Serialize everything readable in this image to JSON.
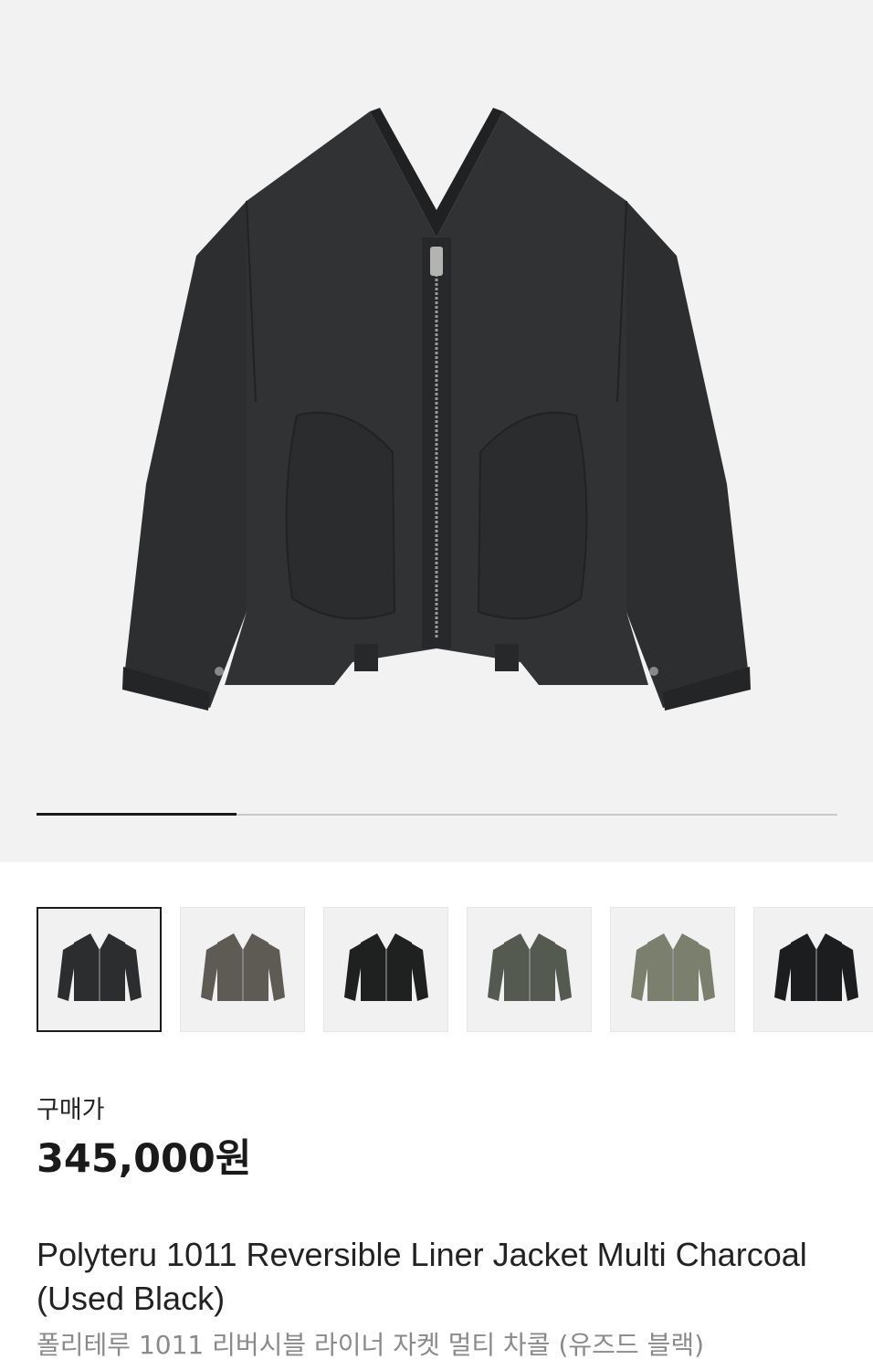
{
  "gallery": {
    "main_image_icon": "jacket-image",
    "current_index": 1,
    "total_images": 4,
    "progress_fraction": 0.25
  },
  "thumbnails": [
    {
      "name": "thumbnail-1",
      "color": "#2b2d2e",
      "selected": true
    },
    {
      "name": "thumbnail-2",
      "color": "#5d5b53",
      "selected": false
    },
    {
      "name": "thumbnail-3",
      "color": "#1f2020",
      "selected": false
    },
    {
      "name": "thumbnail-4",
      "color": "#545a4f",
      "selected": false
    },
    {
      "name": "thumbnail-5",
      "color": "#7a7f6e",
      "selected": false
    },
    {
      "name": "thumbnail-6",
      "color": "#1c1d1e",
      "selected": false
    }
  ],
  "price": {
    "label": "구매가",
    "value": "345,000원"
  },
  "product": {
    "title_en": "Polyteru 1011 Reversible Liner Jacket Multi Charcoal (Used Black)",
    "title_ko": "폴리테루 1011 리버시블 라이너 자켓 멀티 차콜 (유즈드 블랙)"
  }
}
